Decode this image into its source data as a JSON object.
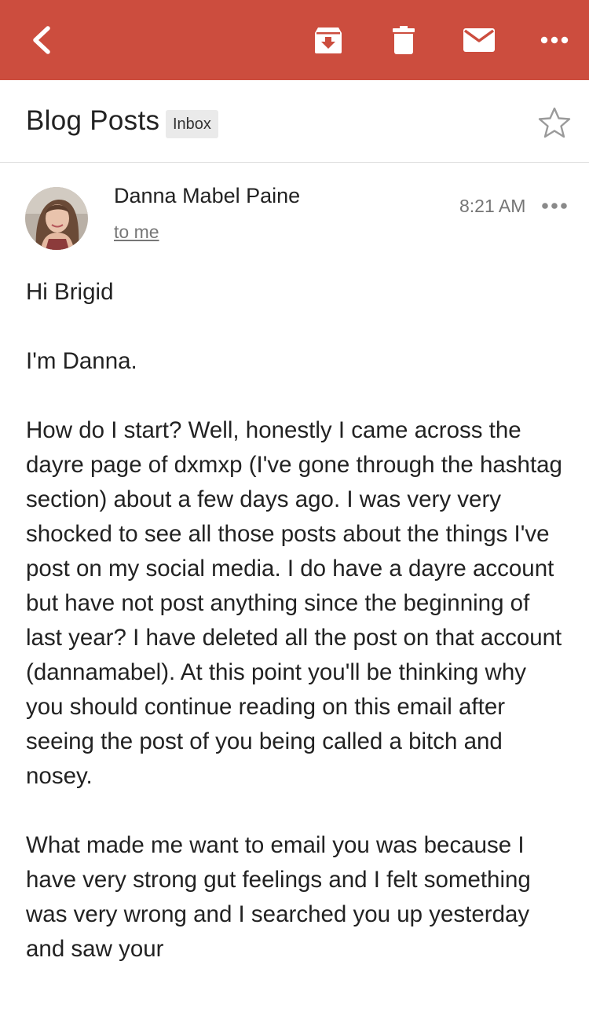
{
  "colors": {
    "appbar": "#cc4d3e",
    "icon": "#ffffff",
    "text": "#222222",
    "muted": "#757575"
  },
  "toolbar": {
    "back_icon": "arrow-back-icon",
    "archive_icon": "archive-icon",
    "delete_icon": "trash-icon",
    "mark_unread_icon": "mail-icon",
    "more_icon": "more-horizontal-icon"
  },
  "subject": {
    "title": "Blog Posts",
    "label": "Inbox",
    "star_icon": "star-outline-icon"
  },
  "message": {
    "sender": "Danna Mabel Paine",
    "recipient": "to me",
    "time": "8:21 AM",
    "more_icon": "more-horizontal-icon",
    "avatar_icon": "avatar-photo",
    "paragraphs": [
      "Hi Brigid",
      "I'm Danna.",
      "How do I start? Well, honestly I came across the dayre page of dxmxp (I've gone through the hashtag section) about a few days ago. I was very very shocked to see all those posts about the things I've post on my social media. I do have a dayre account but have not post anything since the beginning of last year? I have deleted all the post on that account (dannamabel). At this point you'll be thinking why you should continue reading on this email after seeing the post of you being called a bitch and nosey.",
      "What made me want to email you was because I have very strong gut feelings and I felt something was very wrong and I searched you up yesterday and saw your"
    ]
  }
}
